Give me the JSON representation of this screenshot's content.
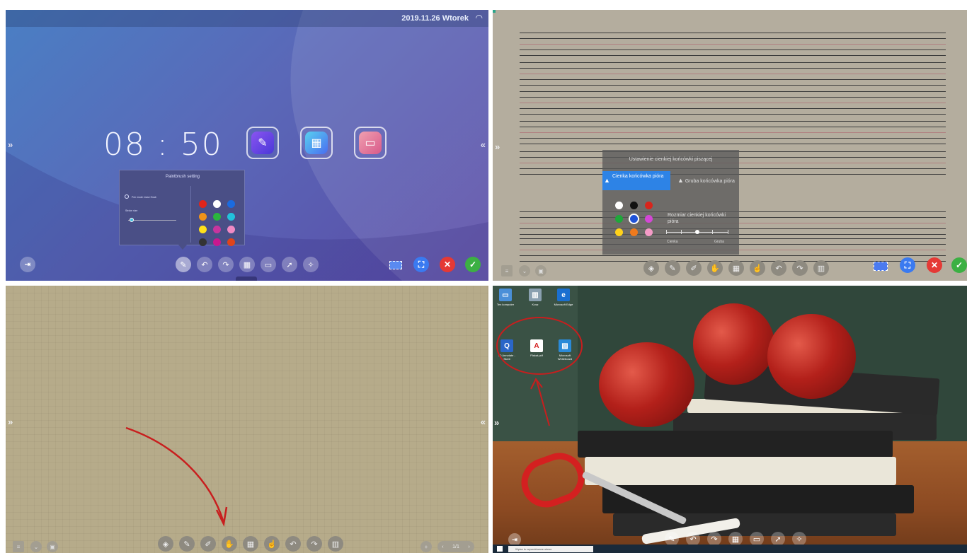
{
  "q1": {
    "status": {
      "date": "2019.11.26 Wtorek",
      "wifi_icon": "wifi-icon"
    },
    "clock": "08 : 50",
    "apps": [
      {
        "name": "note-app-icon",
        "color": "#6b49e8"
      },
      {
        "name": "apps-grid-icon",
        "color": "#4aa0f0"
      },
      {
        "name": "folder-icon",
        "color": "#e86a7a"
      }
    ],
    "paintbrush": {
      "title": "Paintbrush setting",
      "eraser_label": "Pen mode erase Enab",
      "stroke_label": "Stroke size",
      "colors": [
        "#e0241b",
        "#ffffff",
        "#1b6be0",
        "#f0931a",
        "#2bb53d",
        "#22c2dc",
        "#ffe01a",
        "#c7349e",
        "#f08ac4",
        "#333333",
        "#c7188f",
        "#e0441b"
      ]
    },
    "toolbar": [
      "pen-icon",
      "undo-icon",
      "redo-icon",
      "grid-icon",
      "presentation-icon",
      "cursor-icon",
      "brush-clear-icon"
    ]
  },
  "q2": {
    "panel": {
      "title": "Ustawienie cienkiej końcówki piszącej",
      "thin": "Cienka końcówka pióra",
      "thick": "Gruba końcówka pióra",
      "size": "Rozmiar cienkiej końcówki pióra",
      "low": "Cienka",
      "high": "Gruba",
      "colors": [
        "#ffffff",
        "#111111",
        "#d8251c",
        "#1ea83a",
        "#1f52d8",
        "#d447d6",
        "#ffd21a",
        "#ef7a1d",
        "#f59bc7"
      ]
    },
    "toolbar": [
      "bucket-icon",
      "pen-icon",
      "marker-icon",
      "hand-icon",
      "grid-icon",
      "touch-icon",
      "undo-icon",
      "redo-icon",
      "trash-icon"
    ]
  },
  "q3": {
    "toolbar": [
      "bucket-icon",
      "pen-icon",
      "marker-icon",
      "hand-icon",
      "grid-icon",
      "touch-icon",
      "undo-icon",
      "redo-icon",
      "trash-icon"
    ],
    "page": "1/1"
  },
  "q4": {
    "desktop_icons": [
      {
        "label": "Ten komputer",
        "name": "this-pc-icon"
      },
      {
        "label": "Kosz",
        "name": "recycle-bin-icon"
      },
      {
        "label": "Microsoft Edge",
        "name": "edge-icon"
      },
      {
        "label": "IQ Annotate - Skrót",
        "name": "iq-annotate-icon"
      },
      {
        "label": "Plakat.pdf",
        "name": "pdf-file-icon"
      },
      {
        "label": "Microsoft Whiteboard",
        "name": "whiteboard-icon"
      }
    ],
    "search": "Wpisz tu wyszukiwane słowo"
  }
}
